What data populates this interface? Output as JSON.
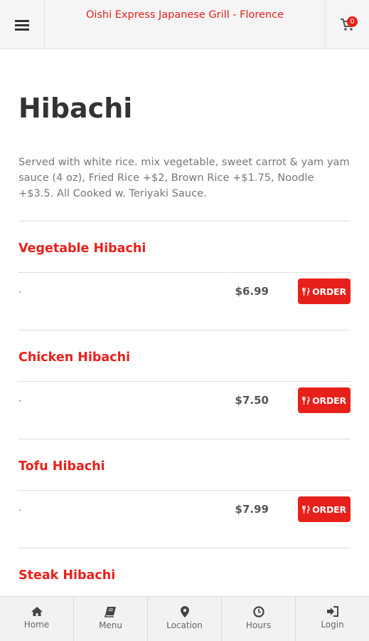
{
  "header": {
    "title": "Oishi Express Japanese Grill - Florence",
    "cart_count": "0"
  },
  "page": {
    "title": "Hibachi",
    "description": "Served with white rice. mix vegetable, sweet carrot & yam yam sauce (4 oz), Fried Rice +$2, Brown Rice +$1.75, Noodle +$3.5. All Cooked w. Teriyaki Sauce."
  },
  "items": [
    {
      "name": "Vegetable Hibachi",
      "desc": ".",
      "price": "$6.99",
      "order_label": "ORDER"
    },
    {
      "name": "Chicken Hibachi",
      "desc": ".",
      "price": "$7.50",
      "order_label": "ORDER"
    },
    {
      "name": "Tofu Hibachi",
      "desc": ".",
      "price": "$7.99",
      "order_label": "ORDER"
    },
    {
      "name": "Steak Hibachi",
      "desc": "",
      "price": "",
      "order_label": ""
    }
  ],
  "nav": [
    {
      "label": "Home",
      "icon": "home-icon"
    },
    {
      "label": "Menu",
      "icon": "book-icon"
    },
    {
      "label": "Location",
      "icon": "map-marker-icon"
    },
    {
      "label": "Hours",
      "icon": "clock-icon"
    },
    {
      "label": "Login",
      "icon": "sign-in-icon"
    }
  ],
  "colors": {
    "accent": "#e8201b",
    "header_bg": "#f5f5f5",
    "nav_bg": "#f2f2f2"
  }
}
